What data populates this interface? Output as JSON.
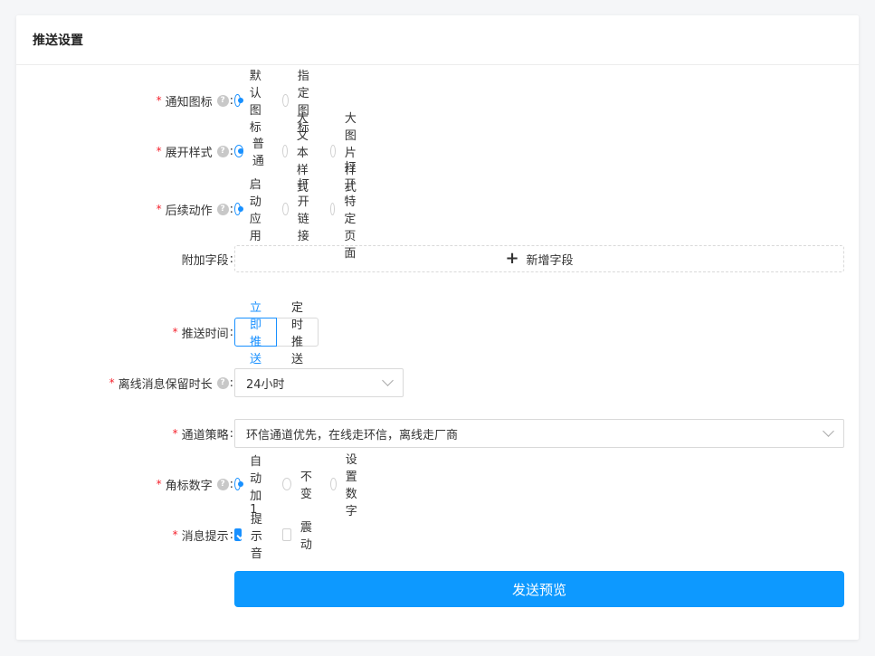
{
  "card": {
    "title": "推送设置"
  },
  "form": {
    "notify_icon": {
      "label": "通知图标",
      "required": "*",
      "options": [
        "默认图标",
        "指定图标"
      ],
      "selected": 0
    },
    "expand_style": {
      "label": "展开样式",
      "required": "*",
      "options": [
        "普通",
        "大文本样式",
        "大图片样式"
      ],
      "selected": 0
    },
    "follow_action": {
      "label": "后续动作",
      "required": "*",
      "options": [
        "启动应用",
        "打开链接",
        "打开特定页面"
      ],
      "selected": 0
    },
    "extra_fields": {
      "label": "附加字段",
      "button_label": "新增字段"
    },
    "push_time": {
      "label": "推送时间",
      "required": "*",
      "options": [
        "立即推送",
        "定时推送"
      ],
      "selected": 0
    },
    "offline_retention": {
      "label": "离线消息保留时长",
      "required": "*",
      "value": "24小时"
    },
    "channel_strategy": {
      "label": "通道策略",
      "required": "*",
      "value": "环信通道优先，在线走环信，离线走厂商"
    },
    "badge_number": {
      "label": "角标数字",
      "required": "*",
      "options": [
        "自动加1",
        "不变",
        "设置数字"
      ],
      "selected": 0
    },
    "message_alert": {
      "label": "消息提示",
      "required": "*",
      "options": [
        "提示音",
        "震动"
      ],
      "checked": [
        true,
        false
      ]
    },
    "submit_label": "发送预览"
  },
  "icons": {
    "help": "question-circle-icon",
    "plus": "plus-icon",
    "chevron": "chevron-down-icon"
  },
  "colors": {
    "primary": "#1890ff",
    "button": "#0d99ff",
    "required": "#f5222d"
  }
}
